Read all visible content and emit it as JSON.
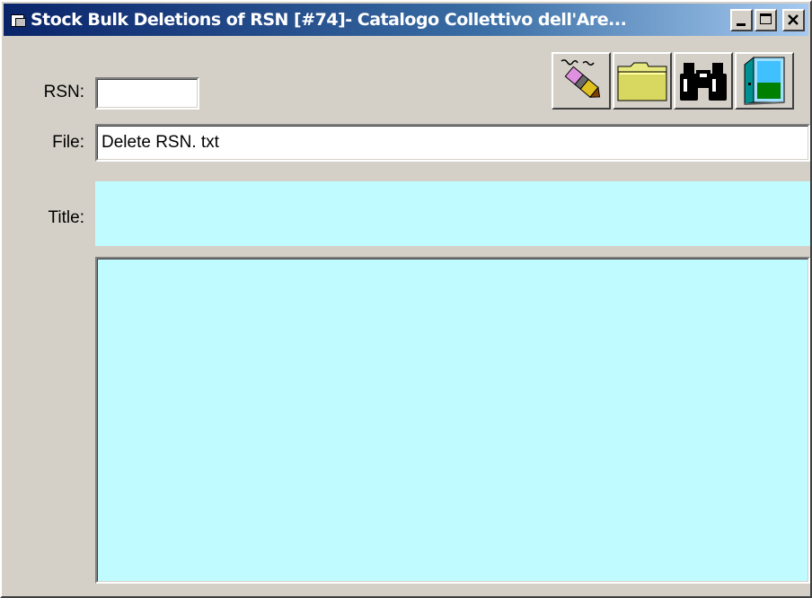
{
  "window": {
    "title": "Stock Bulk Deletions of RSN  [#74]- Catalogo Collettivo dell'Are..."
  },
  "toolbar": {
    "buttons": [
      {
        "name": "erase-button",
        "icon": "eraser-icon"
      },
      {
        "name": "open-folder-button",
        "icon": "folder-icon"
      },
      {
        "name": "find-button",
        "icon": "binoculars-icon"
      },
      {
        "name": "exit-button",
        "icon": "exit-door-icon"
      }
    ]
  },
  "form": {
    "rsn_label": "RSN:",
    "rsn_value": "",
    "file_label": "File:",
    "file_value": "Delete RSN. txt",
    "title_label": "Title:",
    "title_value": "",
    "details_value": ""
  },
  "colors": {
    "face": "#d4d0c8",
    "titlebar_start": "#0a246a",
    "titlebar_end": "#a6caf0",
    "readonly_bg": "#c0fcff"
  }
}
